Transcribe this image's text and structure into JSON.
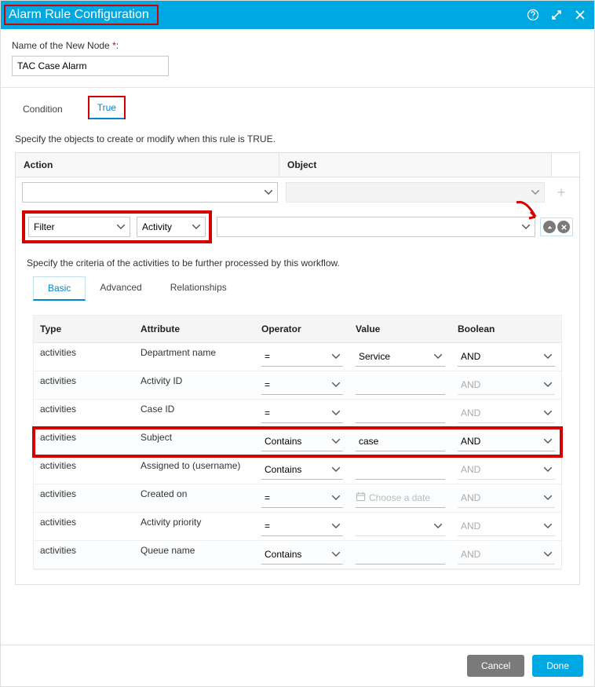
{
  "title": "Alarm Rule Configuration",
  "name_field": {
    "label": "Name of the New Node",
    "required_mark": "*",
    "value": "TAC Case Alarm"
  },
  "main_tabs": {
    "condition": "Condition",
    "true": "True"
  },
  "instruction_true": "Specify the objects to create or modify when this rule is TRUE.",
  "ao_headers": {
    "action": "Action",
    "object": "Object"
  },
  "action_select_1": "",
  "object_select_1": "",
  "filter_label": "Filter",
  "activity_label": "Activity",
  "instruction_criteria": "Specify the criteria of the activities to be further processed by this workflow.",
  "sub_tabs": {
    "basic": "Basic",
    "advanced": "Advanced",
    "relationships": "Relationships"
  },
  "grid_headers": {
    "type": "Type",
    "attribute": "Attribute",
    "operator": "Operator",
    "value": "Value",
    "boolean": "Boolean"
  },
  "rows": [
    {
      "type": "activities",
      "attribute": "Department name",
      "operator": "=",
      "value": "Service",
      "value_kind": "select",
      "boolean": "AND",
      "bool_dim": false
    },
    {
      "type": "activities",
      "attribute": "Activity ID",
      "operator": "=",
      "value": "",
      "value_kind": "input",
      "boolean": "AND",
      "bool_dim": true
    },
    {
      "type": "activities",
      "attribute": "Case ID",
      "operator": "=",
      "value": "",
      "value_kind": "input",
      "boolean": "AND",
      "bool_dim": true
    },
    {
      "type": "activities",
      "attribute": "Subject",
      "operator": "Contains",
      "value": "case",
      "value_kind": "input",
      "boolean": "AND",
      "bool_dim": false,
      "highlight": true
    },
    {
      "type": "activities",
      "attribute": "Assigned to (username)",
      "operator": "Contains",
      "value": "",
      "value_kind": "input",
      "boolean": "AND",
      "bool_dim": true
    },
    {
      "type": "activities",
      "attribute": "Created on",
      "operator": "=",
      "value": "",
      "value_kind": "date",
      "boolean": "AND",
      "bool_dim": true,
      "placeholder": "Choose a date"
    },
    {
      "type": "activities",
      "attribute": "Activity priority",
      "operator": "=",
      "value": "",
      "value_kind": "select",
      "boolean": "AND",
      "bool_dim": true
    },
    {
      "type": "activities",
      "attribute": "Queue name",
      "operator": "Contains",
      "value": "",
      "value_kind": "input",
      "boolean": "AND",
      "bool_dim": true
    }
  ],
  "footer": {
    "cancel": "Cancel",
    "done": "Done"
  }
}
